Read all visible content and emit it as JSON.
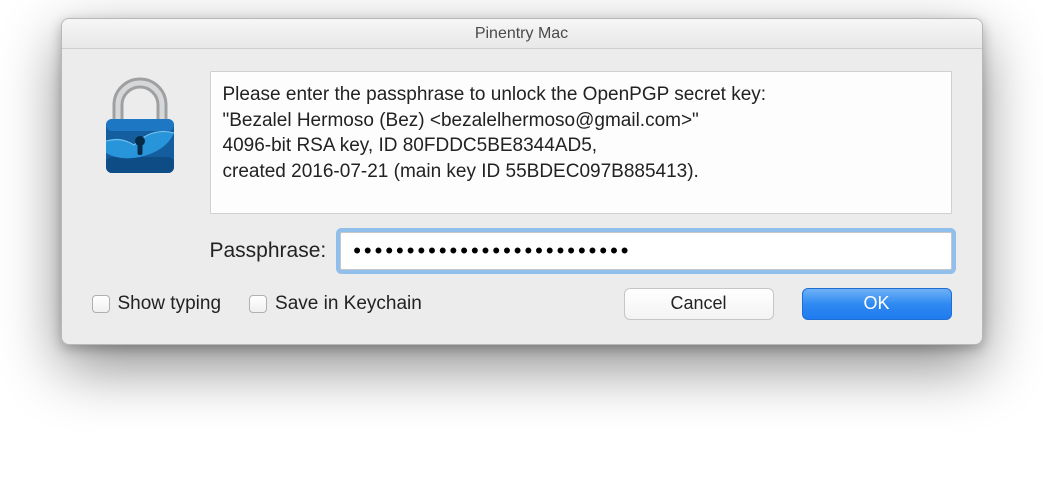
{
  "titlebar": {
    "title": "Pinentry Mac"
  },
  "message": {
    "line1": "Please enter the passphrase to unlock the OpenPGP secret key:",
    "line2": "\"Bezalel Hermoso (Bez) <bezalelhermoso@gmail.com>\"",
    "line3": "4096-bit RSA key, ID 80FDDC5BE8344AD5,",
    "line4": "created 2016-07-21 (main key ID 55BDEC097B885413)."
  },
  "passphrase": {
    "label": "Passphrase:",
    "masked_value": "••••••••••••••••••••••••••"
  },
  "checkboxes": {
    "show_typing": "Show typing",
    "save_keychain": "Save in Keychain"
  },
  "buttons": {
    "cancel": "Cancel",
    "ok": "OK"
  }
}
